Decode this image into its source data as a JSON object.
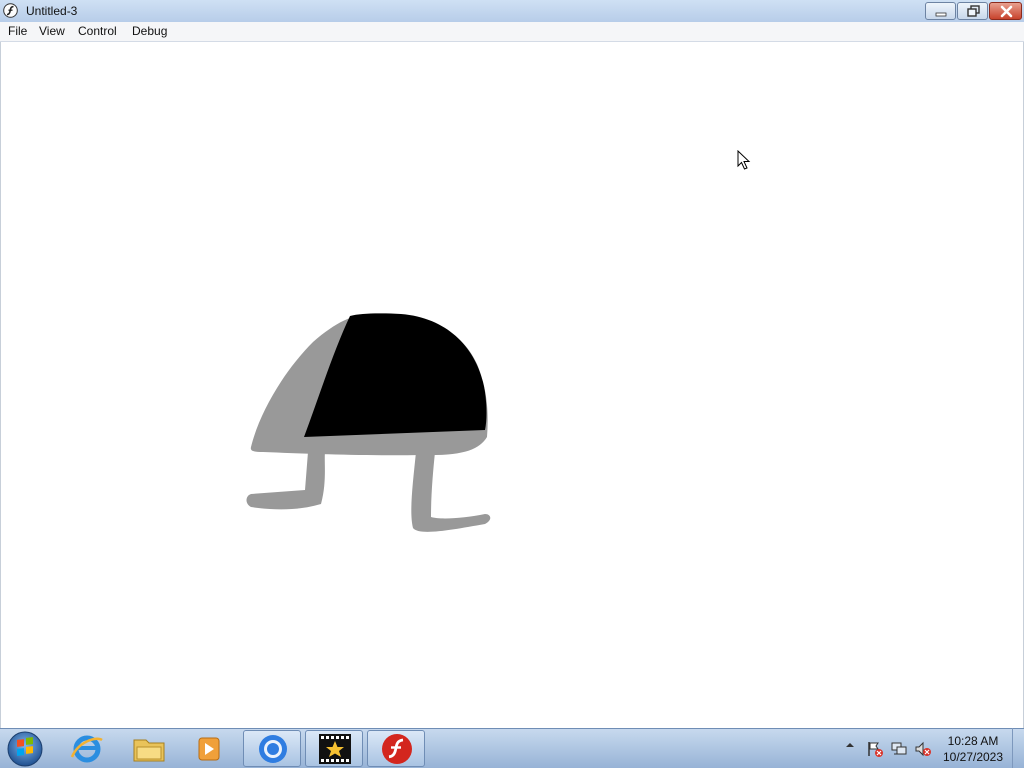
{
  "window": {
    "title": "Untitled-3"
  },
  "menu": [
    "File",
    "View",
    "Control",
    "Debug"
  ],
  "taskbar": {
    "pinned": [
      {
        "name": "internet-explorer-icon"
      },
      {
        "name": "file-explorer-icon"
      },
      {
        "name": "media-player-icon"
      },
      {
        "name": "chrome-icon"
      },
      {
        "name": "movie-maker-icon"
      },
      {
        "name": "flash-player-icon"
      }
    ]
  },
  "tray": {
    "time": "10:28 AM",
    "date": "10/27/2023"
  },
  "colors": {
    "figure_body": "#000000",
    "figure_shadow": "#999999",
    "stage_bg": "#ffffff"
  }
}
